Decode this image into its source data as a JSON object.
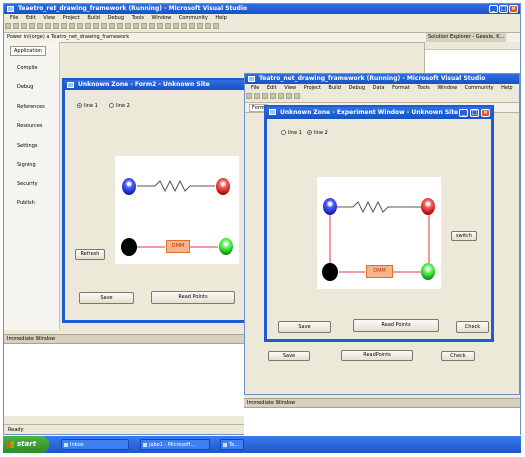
{
  "vs1": {
    "title": "Teaetro_ret_drawing_framework (Running) - Microsoft Visual Studio",
    "menu": [
      "File",
      "Edit",
      "View",
      "Project",
      "Build",
      "Debug",
      "Tools",
      "Window",
      "Community",
      "Help"
    ],
    "address": "Power ini(orge) a Teatro_net_drawing_framework",
    "solution_explorer": "Solution Explorer - Geexle, K...",
    "side_items": [
      "Application",
      "Compile",
      "Debug",
      "References",
      "Resources",
      "Settings",
      "Signing",
      "Security",
      "Publish"
    ],
    "immediate_window": "Immediate Window",
    "status": "Ready"
  },
  "form2": {
    "title": "Unknown Zone - Form2 - Unknown Site",
    "radio1": "line 1",
    "radio2": "line 2",
    "refresh": "Refresh",
    "save": "Save",
    "read_points": "Read Points",
    "dmm": "DMM"
  },
  "vs2": {
    "title": "Teatro_net_drawing_framework (Running) - Microsoft Visual Studio",
    "menu": [
      "File",
      "Edit",
      "View",
      "Project",
      "Build",
      "Debug",
      "Data",
      "Format",
      "Tools",
      "Window",
      "Community",
      "Help"
    ],
    "tab": "Form",
    "save": "Save",
    "read_points": "ReadPoints",
    "check": "Check",
    "immediate_window": "Immediate Window"
  },
  "exp": {
    "title": "Unknown Zone - Experiment Window - Unknown Site",
    "radio1": "line 1",
    "radio2": "line 2",
    "side_button": "switch",
    "save": "Save",
    "read_points": "Read Points",
    "check": "Check",
    "dmm": "DMM"
  },
  "taskbar": {
    "start": "start",
    "items": [
      "Inbox",
      "jabe1 - Microsoft...",
      "Te..."
    ]
  },
  "colors": {
    "xp_blue": "#1f5bd6",
    "dialog_bg": "#ece9d8",
    "taskbar": "#245edb",
    "start_green": "#3c9c35",
    "wire_red": "#e03a3a",
    "dmm_orange": "#f7b38a"
  }
}
